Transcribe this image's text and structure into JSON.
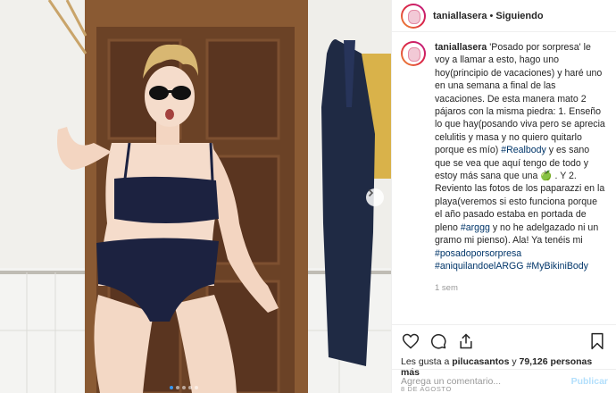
{
  "post": {
    "username": "taniallasera",
    "follow_separator": "•",
    "follow_label": "Siguiendo"
  },
  "caption": {
    "username": "taniallasera",
    "part1": " 'Posado por sorpresa' le voy a llamar a esto, hago uno hoy(principio de vacaciones) y haré uno en una semana a final de las vacaciones. De esta manera mato 2 pájaros con la misma piedra: 1. Enseño lo que hay(posando viva pero se aprecia celulitis y masa y no quiero quitarlo porque es mío) ",
    "tag1": "#Realbody",
    "part2": " y es sano que se vea que aquí tengo de todo y estoy más sana que una ",
    "emoji": "🍏",
    "part3": " . Y 2. Reviento las fotos de los paparazzi en la playa(veremos si esto funciona porque el año pasado estaba en portada de pleno ",
    "tag2": "#arggg",
    "part4": " y no he adelgazado ni un gramo mi pienso). Ala! Ya tenéis mi ",
    "tag3": "#posadoporsorpresa",
    "part5": " ",
    "tag4": "#aniquilandoelARGG",
    "part6": " ",
    "tag5": "#MyBikiniBody",
    "time": "1 sem"
  },
  "actions": {
    "icons": [
      "heart-icon",
      "comment-icon",
      "share-icon",
      "bookmark-icon"
    ]
  },
  "likes": {
    "prefix": "Les gusta a ",
    "user": "pilucasantos",
    "middle": " y ",
    "count": "79,126 personas más"
  },
  "date": "8 DE AGOSTO",
  "comment_box": {
    "placeholder": "Agrega un comentario...",
    "publish_label": "Publicar"
  },
  "carousel": {
    "dot_count": 5,
    "active_index": 0
  },
  "colors": {
    "link": "#003569",
    "muted": "#999999",
    "publish_disabled": "#b2dffc",
    "carousel_active": "#3897f0"
  }
}
